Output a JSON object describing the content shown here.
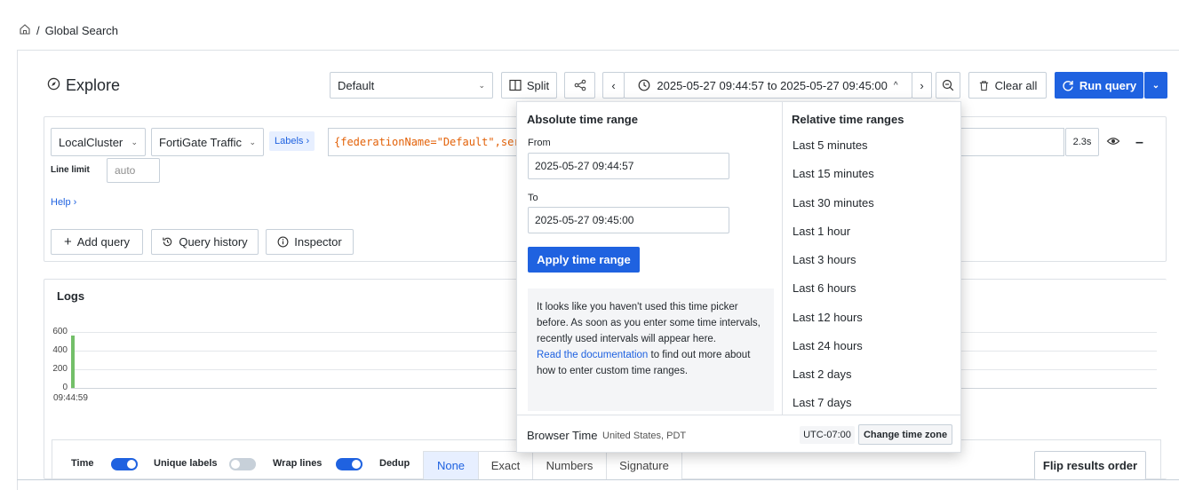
{
  "breadcrumb": {
    "separator": "/",
    "current": "Global Search"
  },
  "explore": {
    "title": "Explore",
    "datasource": "Default",
    "split_label": "Split",
    "time_range_label": "2025-05-27 09:44:57 to 2025-05-27 09:45:00",
    "clear_all_label": "Clear all",
    "run_query_label": "Run query"
  },
  "query": {
    "cluster": "LocalCluster",
    "stream": "FortiGate Traffic",
    "labels_label": "Labels ›",
    "expression": "{federationName=\"Default\",ser",
    "duration": "2.3s",
    "line_limit_label": "Line limit",
    "line_limit_placeholder": "auto",
    "help_label": "Help ›",
    "add_query_label": "Add query",
    "query_history_label": "Query history",
    "inspector_label": "Inspector"
  },
  "logs": {
    "title": "Logs",
    "y_ticks": [
      "600",
      "400",
      "200",
      "0"
    ],
    "x_tick": "09:44:59",
    "bar_color": "#73bf69",
    "bar_value": 560,
    "y_max": 600
  },
  "toolbar": {
    "time_label": "Time",
    "time_on": true,
    "unique_labels_label": "Unique labels",
    "unique_labels_on": false,
    "wrap_lines_label": "Wrap lines",
    "wrap_lines_on": true,
    "dedup_label": "Dedup",
    "dedup_options": [
      "None",
      "Exact",
      "Numbers",
      "Signature"
    ],
    "dedup_selected": "None",
    "flip_label": "Flip results order"
  },
  "time_picker": {
    "absolute_title": "Absolute time range",
    "from_label": "From",
    "from_value": "2025-05-27 09:44:57",
    "to_label": "To",
    "to_value": "2025-05-27 09:45:00",
    "apply_label": "Apply time range",
    "info_text": "It looks like you haven't used this time picker before. As soon as you enter some time intervals, recently used intervals will appear here.",
    "doc_link": "Read the documentation",
    "doc_suffix": " to find out more about how to enter custom time ranges.",
    "relative_title": "Relative time ranges",
    "relative": [
      "Last 5 minutes",
      "Last 15 minutes",
      "Last 30 minutes",
      "Last 1 hour",
      "Last 3 hours",
      "Last 6 hours",
      "Last 12 hours",
      "Last 24 hours",
      "Last 2 days",
      "Last 7 days"
    ],
    "browser_time_label": "Browser Time",
    "browser_region": "United States, PDT",
    "utc_offset": "UTC-07:00",
    "change_tz_label": "Change time zone"
  },
  "colors": {
    "accent": "#1f62e0",
    "code": "#e36209",
    "link": "#1f62e0"
  }
}
